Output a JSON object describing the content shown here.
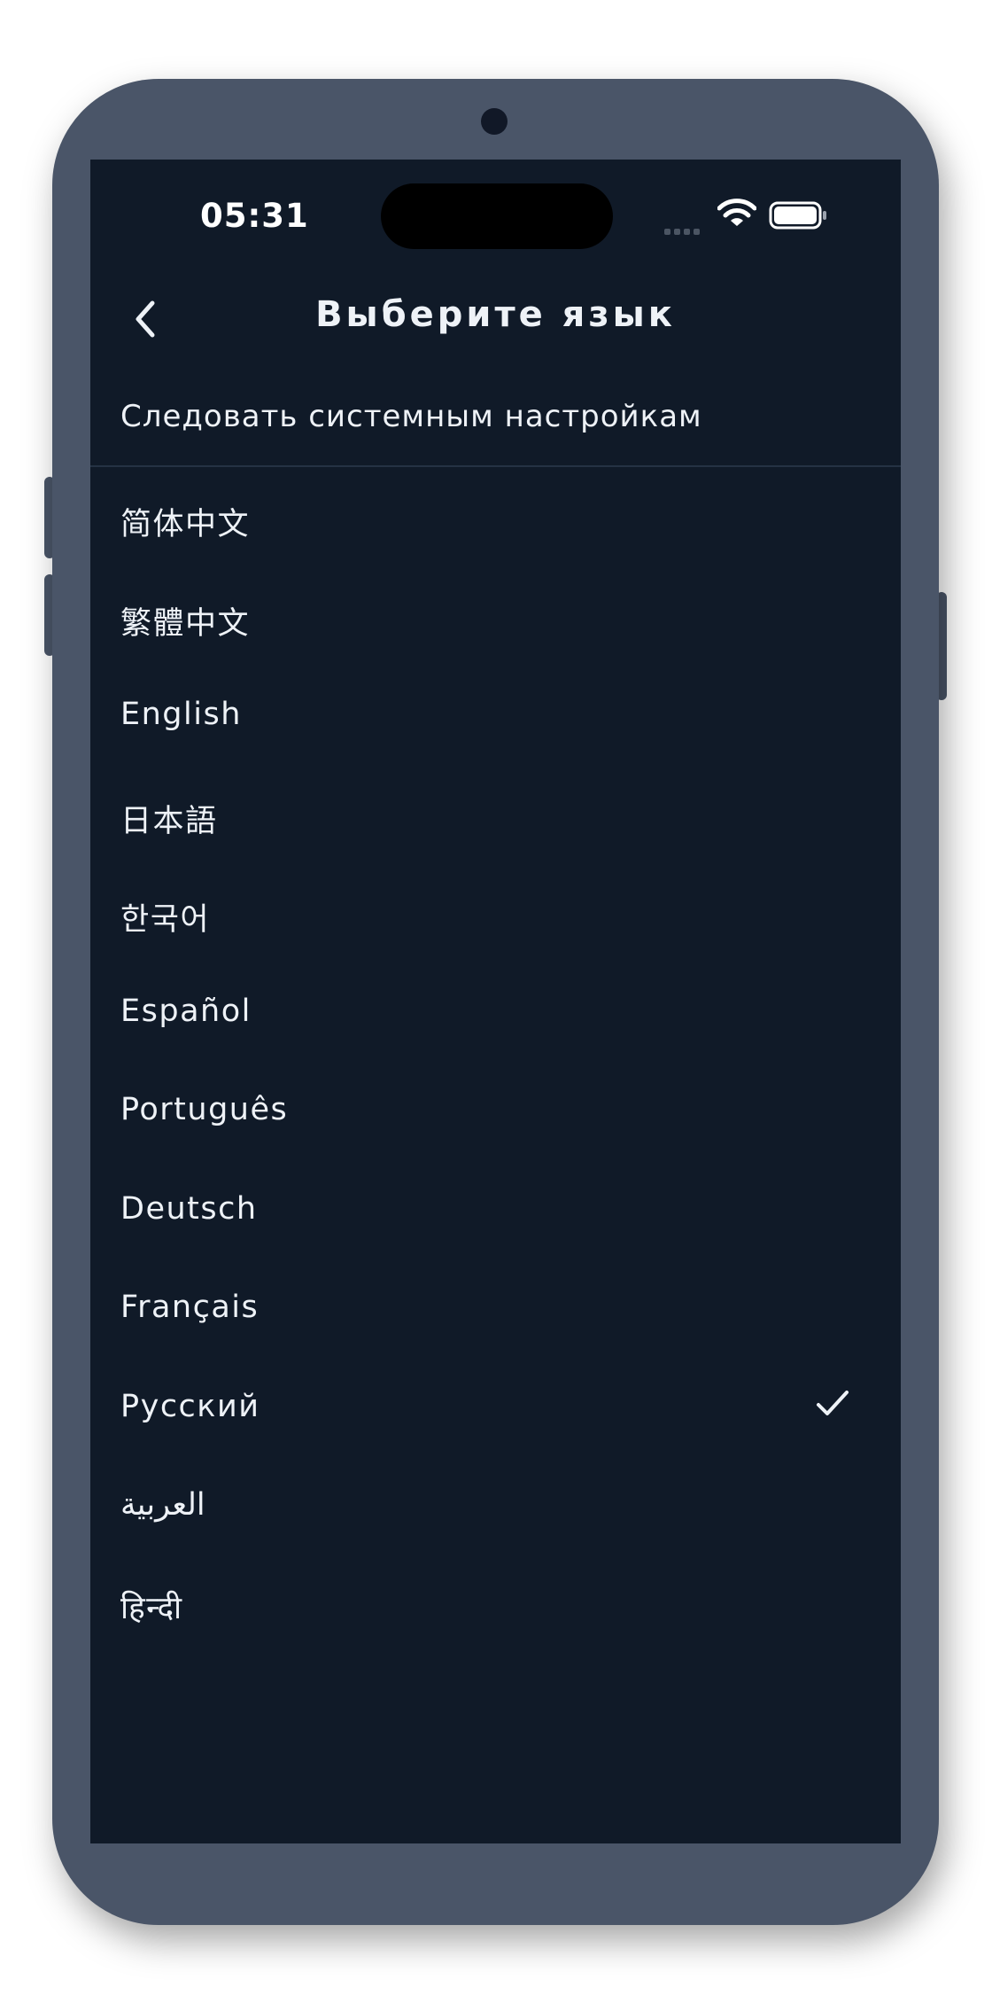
{
  "status_bar": {
    "time": "05:31",
    "icons": [
      "cellular-signal-icon",
      "wifi-icon",
      "battery-icon"
    ]
  },
  "header": {
    "title": "Выберите язык",
    "back_icon": "chevron-left-icon"
  },
  "follow_system": {
    "label": "Следовать системным настройкам"
  },
  "languages": [
    {
      "label": "简体中文",
      "selected": false
    },
    {
      "label": "繁體中文",
      "selected": false
    },
    {
      "label": "English",
      "selected": false
    },
    {
      "label": "日本語",
      "selected": false
    },
    {
      "label": "한국어",
      "selected": false
    },
    {
      "label": "Español",
      "selected": false
    },
    {
      "label": "Português",
      "selected": false
    },
    {
      "label": "Deutsch",
      "selected": false
    },
    {
      "label": "Français",
      "selected": false
    },
    {
      "label": "Русский",
      "selected": true
    },
    {
      "label": "العربية",
      "selected": false
    },
    {
      "label": "हिन्दी",
      "selected": false
    }
  ],
  "colors": {
    "screen_background": "#101a28",
    "device_frame": "#4a5568",
    "text": "#eef2f7",
    "divider": "#253244"
  }
}
